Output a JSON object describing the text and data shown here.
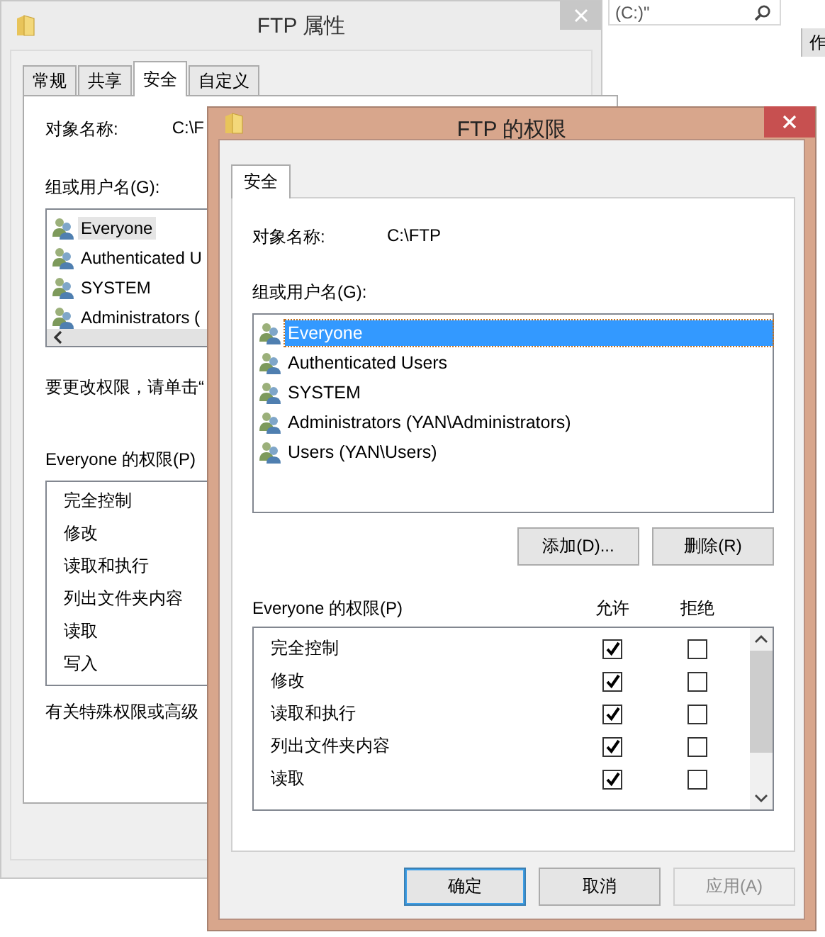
{
  "background_window": {
    "search_field": {
      "value": "(C:)\""
    },
    "column_header": "作"
  },
  "properties_window": {
    "title": "FTP 属性",
    "tabs": [
      {
        "label": "常规",
        "selected": false
      },
      {
        "label": "共享",
        "selected": false
      },
      {
        "label": "安全",
        "selected": true
      },
      {
        "label": "自定义",
        "selected": false
      }
    ],
    "object_name_label": "对象名称:",
    "object_name_value": "C:\\F",
    "groups_label": "组或用户名(G):",
    "groups": [
      {
        "name": "Everyone",
        "selected": true
      },
      {
        "name": "Authenticated U",
        "selected": false
      },
      {
        "name": "SYSTEM",
        "selected": false
      },
      {
        "name": "Administrators (",
        "selected": false
      }
    ],
    "change_hint": "要更改权限，请单击“",
    "permissions_label": "Everyone 的权限(P)",
    "permissions": [
      "完全控制",
      "修改",
      "读取和执行",
      "列出文件夹内容",
      "读取",
      "写入"
    ],
    "advanced_hint": "有关特殊权限或高级"
  },
  "permissions_dialog": {
    "title": "FTP 的权限",
    "tabs": [
      {
        "label": "安全",
        "selected": true
      }
    ],
    "object_name_label": "对象名称:",
    "object_name_value": "C:\\FTP",
    "groups_label": "组或用户名(G):",
    "groups": [
      {
        "name": "Everyone",
        "selected": true
      },
      {
        "name": "Authenticated Users",
        "selected": false
      },
      {
        "name": "SYSTEM",
        "selected": false
      },
      {
        "name": "Administrators (YAN\\Administrators)",
        "selected": false
      },
      {
        "name": "Users (YAN\\Users)",
        "selected": false
      }
    ],
    "group_buttons": [
      "添加(D)...",
      "删除(R)"
    ],
    "permissions_label": "Everyone 的权限(P)",
    "allow_header": "允许",
    "deny_header": "拒绝",
    "permissions": [
      {
        "name": "完全控制",
        "allow": true,
        "deny": false
      },
      {
        "name": "修改",
        "allow": true,
        "deny": false
      },
      {
        "name": "读取和执行",
        "allow": true,
        "deny": false
      },
      {
        "name": "列出文件夹内容",
        "allow": true,
        "deny": false
      },
      {
        "name": "读取",
        "allow": true,
        "deny": false
      }
    ],
    "buttons": [
      {
        "label": "确定",
        "default": true,
        "disabled": false
      },
      {
        "label": "取消",
        "default": false,
        "disabled": false
      },
      {
        "label": "应用(A)",
        "default": false,
        "disabled": true
      }
    ]
  }
}
